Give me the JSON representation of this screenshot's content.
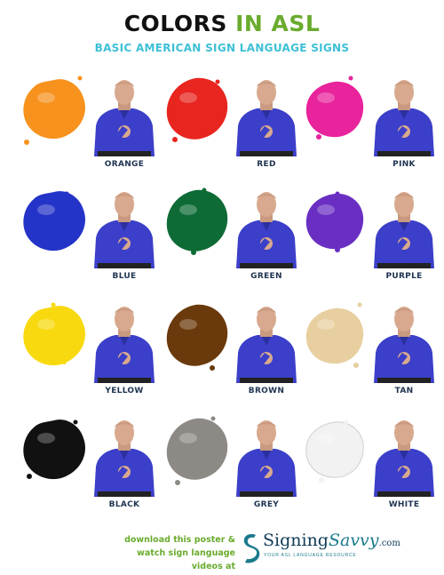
{
  "header": {
    "title_part1": "COLORS",
    "title_part2": "IN ASL",
    "subtitle": "BASIC AMERICAN SIGN LANGUAGE SIGNS",
    "subtitle_color": "#3ec0d6",
    "accent_color": "#6aab2e"
  },
  "signs": [
    {
      "label": "ORANGE",
      "color": "#f7921e"
    },
    {
      "label": "RED",
      "color": "#e8251f"
    },
    {
      "label": "PINK",
      "color": "#e8239b"
    },
    {
      "label": "BLUE",
      "color": "#2433c8"
    },
    {
      "label": "GREEN",
      "color": "#0e6b36"
    },
    {
      "label": "PURPLE",
      "color": "#6a2fc2"
    },
    {
      "label": "YELLOW",
      "color": "#f8d90f"
    },
    {
      "label": "BROWN",
      "color": "#6a3a0c"
    },
    {
      "label": "TAN",
      "color": "#e8cfa0"
    },
    {
      "label": "BLACK",
      "color": "#111111"
    },
    {
      "label": "GREY",
      "color": "#8d8a86"
    },
    {
      "label": "WHITE",
      "color": "#f2f2f2"
    }
  ],
  "footer": {
    "line1": "download this poster &",
    "line2": "watch sign language videos at",
    "color": "#6aab2e"
  },
  "logo": {
    "name_part1": "Signing",
    "name_part2": "Savvy",
    "domain": ".com",
    "tagline": "YOUR ASL LANGUAGE RESOURCE"
  }
}
